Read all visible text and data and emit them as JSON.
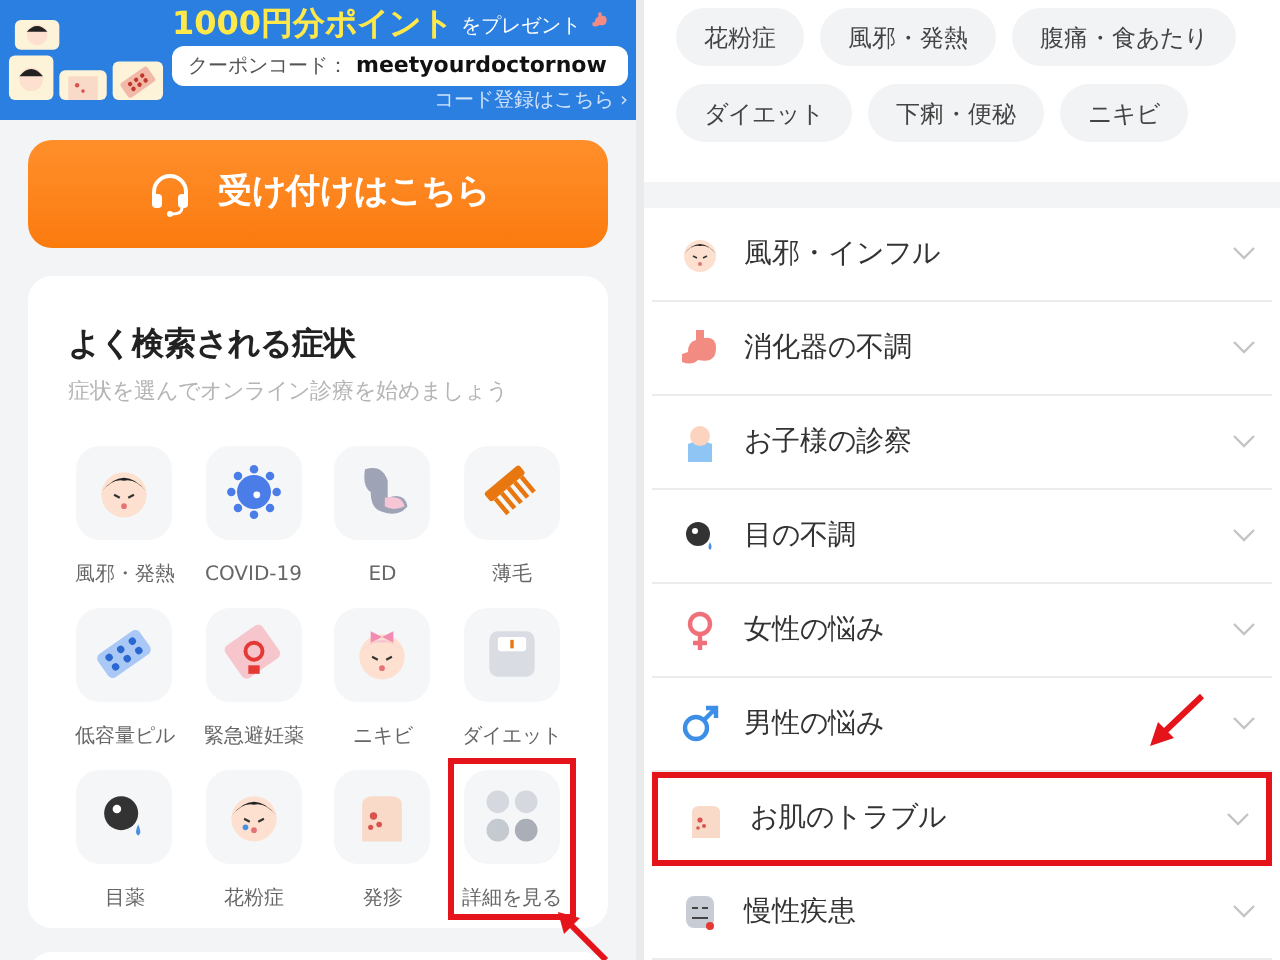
{
  "banner": {
    "headline_highlight": "1000円分ポイント",
    "headline_rest": "をプレゼント",
    "coupon_label": "クーポンコード：",
    "coupon_code": "meetyourdoctornow",
    "register_link": "コード登録はこちら ›"
  },
  "reception_button": {
    "label": "受け付けはこちら"
  },
  "symptom_card": {
    "title": "よく検索される症状",
    "subtitle": "症状を選んでオンライン診療を始めましょう",
    "items": [
      {
        "label": "風邪・発熱",
        "highlighted": false
      },
      {
        "label": "COVID-19",
        "highlighted": false
      },
      {
        "label": "ED",
        "highlighted": false
      },
      {
        "label": "薄毛",
        "highlighted": false
      },
      {
        "label": "低容量ピル",
        "highlighted": false
      },
      {
        "label": "緊急避妊薬",
        "highlighted": false
      },
      {
        "label": "ニキビ",
        "highlighted": false
      },
      {
        "label": "ダイエット",
        "highlighted": false
      },
      {
        "label": "目薬",
        "highlighted": false
      },
      {
        "label": "花粉症",
        "highlighted": false
      },
      {
        "label": "発疹",
        "highlighted": false
      },
      {
        "label": "詳細を見る",
        "highlighted": true
      }
    ]
  },
  "tags": [
    "花粉症",
    "風邪・発熱",
    "腹痛・食あたり",
    "ダイエット",
    "下痢・便秘",
    "ニキビ"
  ],
  "categories": [
    {
      "label": "風邪・インフル",
      "highlighted": false
    },
    {
      "label": "消化器の不調",
      "highlighted": false
    },
    {
      "label": "お子様の診察",
      "highlighted": false
    },
    {
      "label": "目の不調",
      "highlighted": false
    },
    {
      "label": "女性の悩み",
      "highlighted": false
    },
    {
      "label": "男性の悩み",
      "highlighted": false
    },
    {
      "label": "お肌のトラブル",
      "highlighted": true
    },
    {
      "label": "慢性疾患",
      "highlighted": false
    }
  ]
}
